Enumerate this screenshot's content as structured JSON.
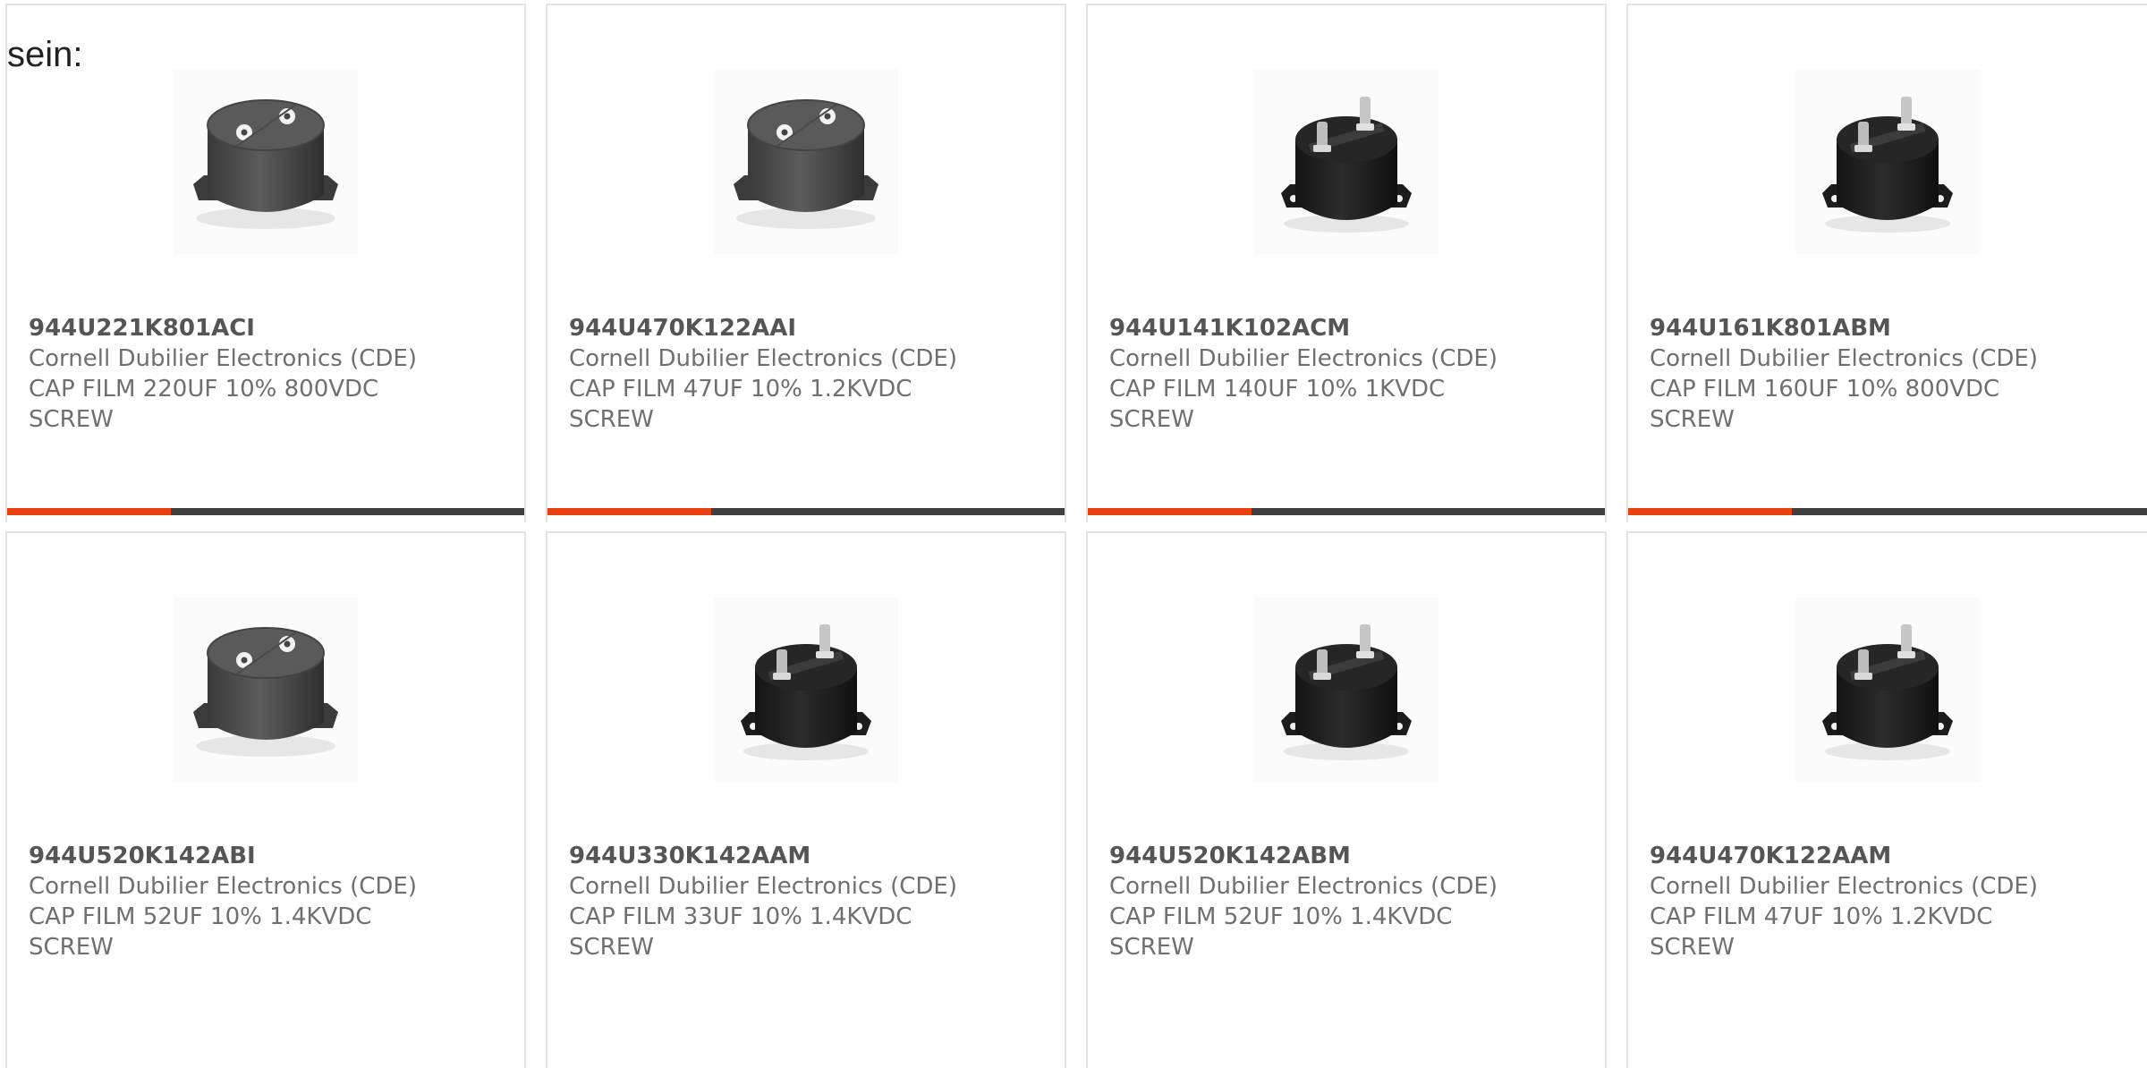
{
  "lead_text": "sein:",
  "colors": {
    "accent": "#e8410f",
    "bar": "#404040",
    "border": "#e2e2e2",
    "text": "#6f6f6f"
  },
  "products": [
    {
      "part_number": "944U221K801ACI",
      "manufacturer": "Cornell Dubilier Electronics (CDE)",
      "description": "CAP FILM 220UF 10% 800VDC",
      "mounting": "SCREW",
      "image": "capacitor-flat-terminals-icon"
    },
    {
      "part_number": "944U470K122AAI",
      "manufacturer": "Cornell Dubilier Electronics (CDE)",
      "description": "CAP FILM 47UF 10% 1.2KVDC",
      "mounting": "SCREW",
      "image": "capacitor-flat-terminals-icon"
    },
    {
      "part_number": "944U141K102ACM",
      "manufacturer": "Cornell Dubilier Electronics (CDE)",
      "description": "CAP FILM 140UF 10% 1KVDC",
      "mounting": "SCREW",
      "image": "capacitor-stud-terminals-icon"
    },
    {
      "part_number": "944U161K801ABM",
      "manufacturer": "Cornell Dubilier Electronics (CDE)",
      "description": "CAP FILM 160UF 10% 800VDC",
      "mounting": "SCREW",
      "image": "capacitor-stud-terminals-icon"
    },
    {
      "part_number": "944U520K142ABI",
      "manufacturer": "Cornell Dubilier Electronics (CDE)",
      "description": "CAP FILM 52UF 10% 1.4KVDC",
      "mounting": "SCREW",
      "image": "capacitor-flat-terminals-icon"
    },
    {
      "part_number": "944U330K142AAM",
      "manufacturer": "Cornell Dubilier Electronics (CDE)",
      "description": "CAP FILM 33UF 10% 1.4KVDC",
      "mounting": "SCREW",
      "image": "capacitor-stud-terminals-icon"
    },
    {
      "part_number": "944U520K142ABM",
      "manufacturer": "Cornell Dubilier Electronics (CDE)",
      "description": "CAP FILM 52UF 10% 1.4KVDC",
      "mounting": "SCREW",
      "image": "capacitor-stud-terminals-icon"
    },
    {
      "part_number": "944U470K122AAM",
      "manufacturer": "Cornell Dubilier Electronics (CDE)",
      "description": "CAP FILM 47UF 10% 1.2KVDC",
      "mounting": "SCREW",
      "image": "capacitor-stud-terminals-icon"
    }
  ]
}
